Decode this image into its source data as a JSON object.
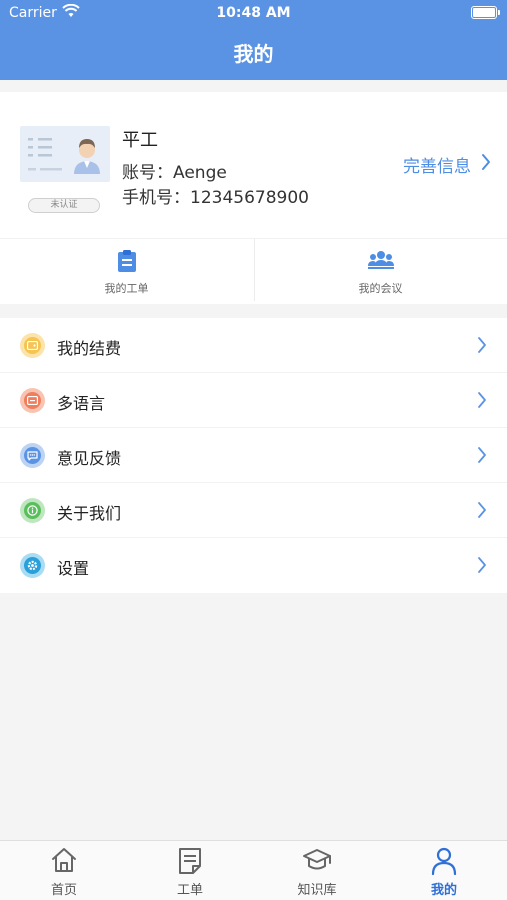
{
  "status_bar": {
    "carrier": "Carrier",
    "time": "10:48 AM"
  },
  "header": {
    "title": "我的"
  },
  "profile": {
    "badge": "未认证",
    "name": "平工",
    "account": "账号：Aenge",
    "phone": "手机号：12345678900",
    "complete_link": "完善信息"
  },
  "quick_actions": [
    {
      "label": "我的工单",
      "icon": "clipboard-icon"
    },
    {
      "label": "我的会议",
      "icon": "meeting-icon"
    }
  ],
  "menu": [
    {
      "label": "我的结费",
      "icon": "wallet-icon",
      "color": "#f5c452"
    },
    {
      "label": "多语言",
      "icon": "language-icon",
      "color": "#f07e5d"
    },
    {
      "label": "意见反馈",
      "icon": "feedback-icon",
      "color": "#5b93e4"
    },
    {
      "label": "关于我们",
      "icon": "info-icon",
      "color": "#59bf5a"
    },
    {
      "label": "设置",
      "icon": "settings-icon",
      "color": "#2a9fd9"
    }
  ],
  "tabbar": {
    "active": "我的",
    "items": [
      {
        "label": "首页",
        "icon": "home-icon"
      },
      {
        "label": "工单",
        "icon": "document-icon"
      },
      {
        "label": "知识库",
        "icon": "graduation-cap-icon"
      },
      {
        "label": "我的",
        "icon": "person-icon"
      }
    ]
  },
  "colors": {
    "accent": "#5b93e4",
    "link": "#4d8ee4",
    "tab_active": "#2f6fd6"
  }
}
